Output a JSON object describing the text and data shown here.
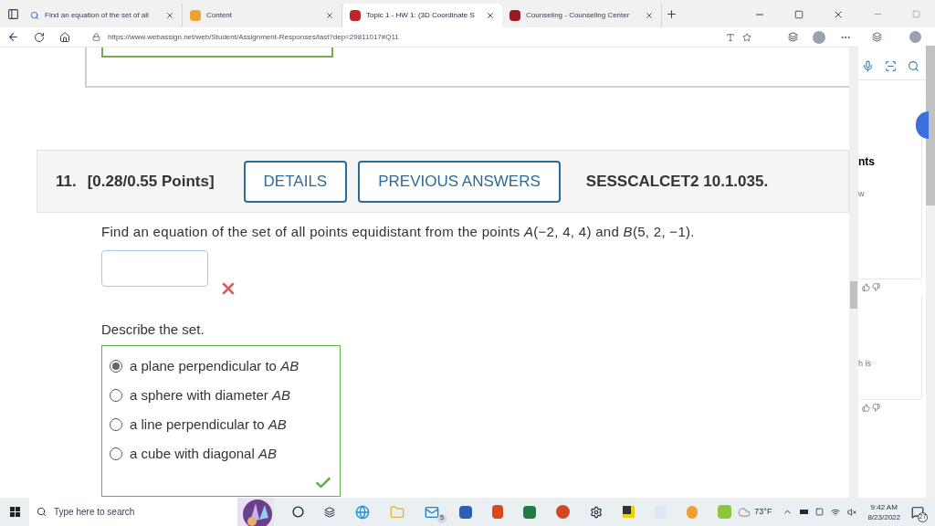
{
  "browser": {
    "tabs": [
      {
        "title": "Find an equation of the set of all",
        "selected": false
      },
      {
        "title": "Content",
        "selected": false
      },
      {
        "title": "Topic 1 - HW 1: (3D Coordinate S",
        "selected": true
      },
      {
        "title": "Counseling - Counseling Center",
        "selected": false
      }
    ],
    "address": "https://www.webassign.net/web/Student/Assignment-Responses/last?dep=29811017#Q11"
  },
  "question": {
    "number": "11.",
    "points": "[0.28/0.55 Points]",
    "buttons": [
      "DETAILS",
      "PREVIOUS ANSWERS"
    ],
    "code": "SESSCALCET2 10.1.035.",
    "prompt": "Find an equation of the set of all points equidistant from the points *A*(−2, 4, 4) and *B*(5, 2, −1).",
    "answer_correct": false,
    "describe_label": "Describe the set.",
    "options": [
      {
        "label": "a plane perpendicular to *AB*",
        "selected": true
      },
      {
        "label": "a sphere with diameter *AB*",
        "selected": false
      },
      {
        "label": "a line perpendicular to *AB*",
        "selected": false
      },
      {
        "label": "a cube with diagonal *AB*",
        "selected": false
      }
    ],
    "options_correct": true
  },
  "side_window": {
    "texts": [
      "nts",
      "w",
      "h is"
    ]
  },
  "taskbar": {
    "search_placeholder": "Type here to search",
    "mail_count": "5",
    "temperature": "73°F",
    "time": "9:42 AM",
    "date": "8/23/2022",
    "notifications": "27"
  }
}
